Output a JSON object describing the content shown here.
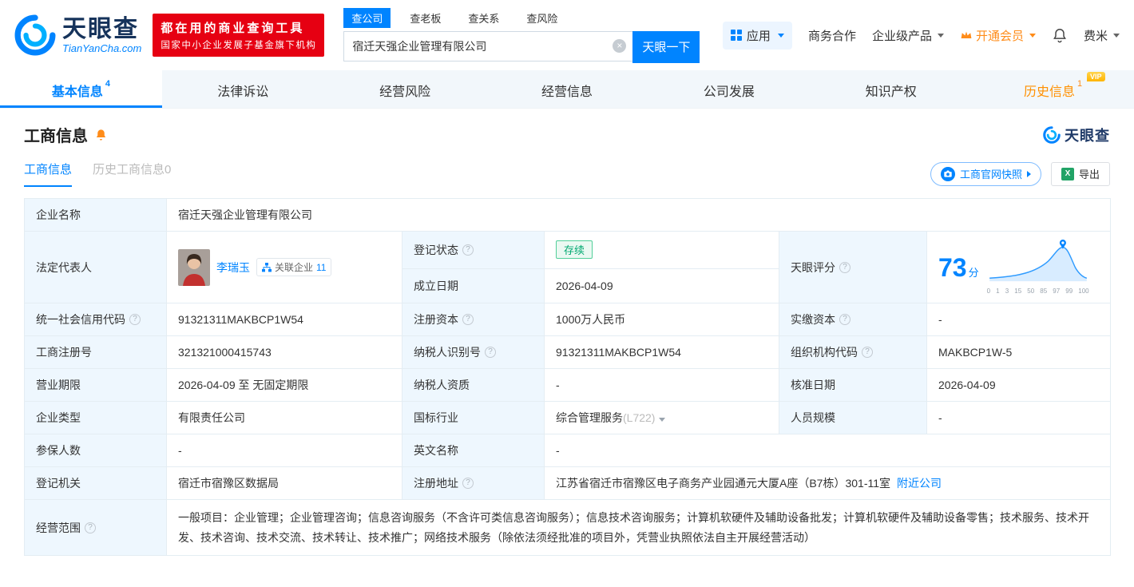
{
  "brand": {
    "name": "天眼查",
    "domain": "TianYanCha.com",
    "slogan_line1": "都在用的商业查询工具",
    "slogan_line2": "国家中小企业发展子基金旗下机构",
    "colors": {
      "primary": "#0084ff",
      "red": "#e60012",
      "orange": "#ff8c19"
    }
  },
  "search": {
    "tabs": [
      {
        "label": "查公司"
      },
      {
        "label": "查老板"
      },
      {
        "label": "查关系"
      },
      {
        "label": "查风险"
      }
    ],
    "value": "宿迁天强企业管理有限公司",
    "submit": "天眼一下"
  },
  "topnav": {
    "apps": "应用",
    "cooperation": "商务合作",
    "enterprise": "企业级产品",
    "vip": "开通会员",
    "user": "费米"
  },
  "tabs": [
    {
      "label": "基本信息",
      "badge": "4"
    },
    {
      "label": "法律诉讼"
    },
    {
      "label": "经营风险"
    },
    {
      "label": "经营信息"
    },
    {
      "label": "公司发展"
    },
    {
      "label": "知识产权"
    },
    {
      "label": "历史信息",
      "badge": "1",
      "vip": "VIP"
    }
  ],
  "section": {
    "title": "工商信息",
    "watermark": "天眼查",
    "subtab_active": "工商信息",
    "subtab_history": "历史工商信息0",
    "snapshot_btn": "工商官网快照",
    "export_btn": "导出"
  },
  "info": {
    "company_name_label": "企业名称",
    "company_name": "宿迁天强企业管理有限公司",
    "legal_rep_label": "法定代表人",
    "legal_rep_name": "李瑞玉",
    "related_companies_label": "关联企业",
    "related_companies_count": "11",
    "reg_status_label": "登记状态",
    "reg_status": "存续",
    "establish_date_label": "成立日期",
    "establish_date": "2026-04-09",
    "score_label": "天眼评分",
    "score_value": "73",
    "score_unit": "分",
    "score_axis": [
      "0",
      "1",
      "3",
      "15",
      "50",
      "85",
      "97",
      "99",
      "100"
    ],
    "credit_code_label": "统一社会信用代码",
    "credit_code": "91321311MAKBCP1W54",
    "reg_capital_label": "注册资本",
    "reg_capital": "1000万人民币",
    "paid_capital_label": "实缴资本",
    "paid_capital": "-",
    "reg_no_label": "工商注册号",
    "reg_no": "321321000415743",
    "taxpayer_id_label": "纳税人识别号",
    "taxpayer_id": "91321311MAKBCP1W54",
    "org_code_label": "组织机构代码",
    "org_code": "MAKBCP1W-5",
    "term_label": "营业期限",
    "term": "2026-04-09 至 无固定期限",
    "taxpayer_qual_label": "纳税人资质",
    "taxpayer_qual": "-",
    "approve_date_label": "核准日期",
    "approve_date": "2026-04-09",
    "type_label": "企业类型",
    "type": "有限责任公司",
    "industry_label": "国标行业",
    "industry": "综合管理服务",
    "industry_code": "(L722)",
    "staff_label": "人员规模",
    "staff": "-",
    "insured_label": "参保人数",
    "insured": "-",
    "en_name_label": "英文名称",
    "en_name": "-",
    "authority_label": "登记机关",
    "authority": "宿迁市宿豫区数据局",
    "address_label": "注册地址",
    "address": "江苏省宿迁市宿豫区电子商务产业园通元大厦A座（B7栋）301-11室",
    "nearby_link": "附近公司",
    "scope_label": "经营范围",
    "scope": "一般项目：企业管理；企业管理咨询；信息咨询服务（不含许可类信息咨询服务）；信息技术咨询服务；计算机软硬件及辅助设备批发；计算机软硬件及辅助设备零售；技术服务、技术开发、技术咨询、技术交流、技术转让、技术推广；网络技术服务（除依法须经批准的项目外，凭营业执照依法自主开展经营活动）"
  }
}
